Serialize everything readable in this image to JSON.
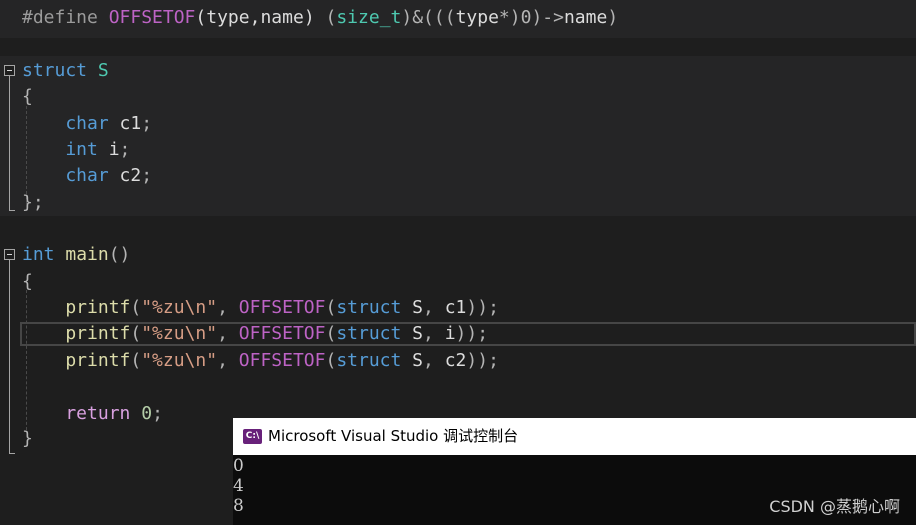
{
  "editor": {
    "lines": [
      {
        "id": "define",
        "tokens": [
          {
            "t": "#define ",
            "c": "pre"
          },
          {
            "t": "OFFSETOF",
            "c": "mac"
          },
          {
            "t": "(",
            "c": "id"
          },
          {
            "t": "type",
            "c": "id"
          },
          {
            "t": ",",
            "c": "id"
          },
          {
            "t": "name",
            "c": "id"
          },
          {
            "t": ")",
            "c": "id"
          },
          {
            "t": " (",
            "c": "pl"
          },
          {
            "t": "size_t",
            "c": "ty"
          },
          {
            "t": ")&(((",
            "c": "pl"
          },
          {
            "t": "type",
            "c": "id"
          },
          {
            "t": "*)",
            "c": "pl"
          },
          {
            "t": "0",
            "c": "pl"
          },
          {
            "t": ")->",
            "c": "pl"
          },
          {
            "t": "name",
            "c": "id"
          },
          {
            "t": ")",
            "c": "pl"
          }
        ]
      },
      {
        "id": "struct-decl",
        "tokens": [
          {
            "t": "struct ",
            "c": "kw"
          },
          {
            "t": "S",
            "c": "ty"
          }
        ]
      },
      {
        "id": "struct-open",
        "tokens": [
          {
            "t": "{",
            "c": "pl"
          }
        ]
      },
      {
        "id": "member-c1",
        "tokens": [
          {
            "t": "    char ",
            "c": "kw"
          },
          {
            "t": "c1",
            "c": "id"
          },
          {
            "t": ";",
            "c": "pl"
          }
        ]
      },
      {
        "id": "member-i",
        "tokens": [
          {
            "t": "    int ",
            "c": "kw"
          },
          {
            "t": "i",
            "c": "id"
          },
          {
            "t": ";",
            "c": "pl"
          }
        ]
      },
      {
        "id": "member-c2",
        "tokens": [
          {
            "t": "    char ",
            "c": "kw"
          },
          {
            "t": "c2",
            "c": "id"
          },
          {
            "t": ";",
            "c": "pl"
          }
        ]
      },
      {
        "id": "struct-close",
        "tokens": [
          {
            "t": "};",
            "c": "pl"
          }
        ]
      },
      {
        "id": "main-decl",
        "tokens": [
          {
            "t": "int ",
            "c": "kw"
          },
          {
            "t": "main",
            "c": "fn"
          },
          {
            "t": "()",
            "c": "pl"
          }
        ]
      },
      {
        "id": "main-open",
        "tokens": [
          {
            "t": "{",
            "c": "pl"
          }
        ]
      },
      {
        "id": "printf-c1",
        "tokens": [
          {
            "t": "    printf",
            "c": "fn"
          },
          {
            "t": "(",
            "c": "pl"
          },
          {
            "t": "\"%zu\\n\"",
            "c": "str"
          },
          {
            "t": ", ",
            "c": "pl"
          },
          {
            "t": "OFFSETOF",
            "c": "mac"
          },
          {
            "t": "(",
            "c": "pl"
          },
          {
            "t": "struct ",
            "c": "kw"
          },
          {
            "t": "S",
            "c": "id"
          },
          {
            "t": ", ",
            "c": "pl"
          },
          {
            "t": "c1",
            "c": "id"
          },
          {
            "t": "));",
            "c": "pl"
          }
        ]
      },
      {
        "id": "printf-i",
        "tokens": [
          {
            "t": "    printf",
            "c": "fn"
          },
          {
            "t": "(",
            "c": "pl"
          },
          {
            "t": "\"%zu\\n\"",
            "c": "str"
          },
          {
            "t": ", ",
            "c": "pl"
          },
          {
            "t": "OFFSETOF",
            "c": "mac"
          },
          {
            "t": "(",
            "c": "pl"
          },
          {
            "t": "struct ",
            "c": "kw"
          },
          {
            "t": "S",
            "c": "id"
          },
          {
            "t": ", ",
            "c": "pl"
          },
          {
            "t": "i",
            "c": "id"
          },
          {
            "t": "));",
            "c": "pl"
          }
        ]
      },
      {
        "id": "printf-c2",
        "tokens": [
          {
            "t": "    printf",
            "c": "fn"
          },
          {
            "t": "(",
            "c": "pl"
          },
          {
            "t": "\"%zu\\n\"",
            "c": "str"
          },
          {
            "t": ", ",
            "c": "pl"
          },
          {
            "t": "OFFSETOF",
            "c": "mac"
          },
          {
            "t": "(",
            "c": "pl"
          },
          {
            "t": "struct ",
            "c": "kw"
          },
          {
            "t": "S",
            "c": "id"
          },
          {
            "t": ", ",
            "c": "pl"
          },
          {
            "t": "c2",
            "c": "id"
          },
          {
            "t": "));",
            "c": "pl"
          }
        ]
      },
      {
        "id": "return",
        "tokens": [
          {
            "t": "    return ",
            "c": "ctl"
          },
          {
            "t": "0",
            "c": "num"
          },
          {
            "t": ";",
            "c": "pl"
          }
        ]
      },
      {
        "id": "main-close",
        "tokens": [
          {
            "t": "}",
            "c": "pl"
          }
        ]
      }
    ]
  },
  "console": {
    "title": "Microsoft Visual Studio 调试控制台",
    "icon": "visual-studio-console-icon",
    "icon_text": "C:\\",
    "output": [
      "0",
      "4",
      "8"
    ]
  },
  "watermark": "CSDN @蒸鹅心啊",
  "colors": {
    "background": "#1e1e1e",
    "keyword": "#569cd6",
    "type": "#4ec9b0",
    "macro": "#bd63c5",
    "function": "#dcdcaa",
    "string": "#d69d85",
    "number": "#b5cea8",
    "control": "#d8a0df"
  }
}
